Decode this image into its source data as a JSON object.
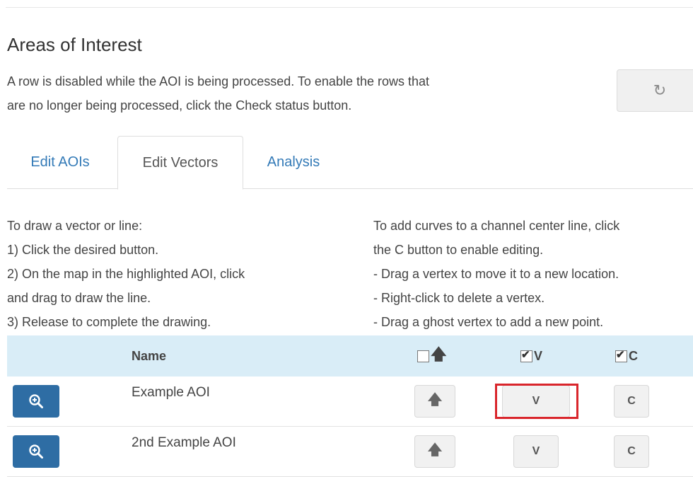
{
  "header": {
    "title": "Areas of Interest",
    "description_lines": [
      "A row is disabled while the AOI is being processed. To enable the rows that",
      "are no longer being processed, click the Check status button."
    ],
    "refresh_icon": "refresh-icon"
  },
  "tabs": [
    {
      "label": "Edit AOIs",
      "active": false
    },
    {
      "label": "Edit Vectors",
      "active": true
    },
    {
      "label": "Analysis",
      "active": false
    }
  ],
  "instructions_left": [
    "To draw a vector or line:",
    "1) Click the desired button.",
    "2) On the map in the highlighted AOI, click",
    "and drag to draw the line.",
    "3) Release to complete the drawing."
  ],
  "instructions_right": [
    "To add curves to a channel center line, click",
    "the C button to enable editing.",
    "- Drag a vertex to move it to a new location.",
    "- Right-click to delete a vertex.",
    "- Drag a ghost vertex to add a new point."
  ],
  "table": {
    "headers": {
      "name": "Name",
      "arrow_checked": false,
      "v_label": "V",
      "v_checked": true,
      "c_label": "C",
      "c_checked": true
    },
    "rows": [
      {
        "name": "Example AOI",
        "v_label": "V",
        "c_label": "C"
      },
      {
        "name": "2nd Example AOI",
        "v_label": "V",
        "c_label": "C"
      }
    ]
  },
  "colors": {
    "link": "#337ab7",
    "header_bg": "#d9edf7",
    "zoom_button": "#2e6da4",
    "highlight": "#d9262c"
  }
}
